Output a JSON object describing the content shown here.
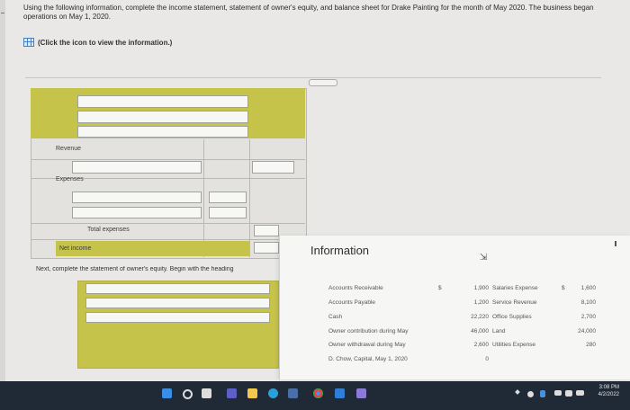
{
  "question": {
    "text": "Using the following information, complete the income statement, statement of owner's equity, and balance sheet for Drake Painting for the month of May 2020. The business began operations on May 1, 2020."
  },
  "info_link": {
    "label": "(Click the icon to view the information.)"
  },
  "income_statement": {
    "revenue_label": "Revenue",
    "expenses_label": "Expenses",
    "total_expenses_label": "Total expenses",
    "net_income_label": "Net income"
  },
  "next_instruction": "Next, complete the statement of owner's equity. Begin with the heading",
  "information_panel": {
    "title": "Information",
    "left_items": [
      {
        "label": "Accounts Receivable",
        "currency": "$",
        "value": "1,900"
      },
      {
        "label": "Accounts Payable",
        "currency": "",
        "value": "1,200"
      },
      {
        "label": "Cash",
        "currency": "",
        "value": "22,220"
      },
      {
        "label": "Owner contribution during May",
        "currency": "",
        "value": "46,000"
      },
      {
        "label": "Owner withdrawal during May",
        "currency": "",
        "value": "2,600"
      },
      {
        "label": "D. Chow, Capital, May 1, 2020",
        "currency": "",
        "value": "0"
      }
    ],
    "right_items": [
      {
        "label": "Salaries Expense",
        "currency": "$",
        "value": "1,600"
      },
      {
        "label": "Service Revenue",
        "currency": "",
        "value": "8,100"
      },
      {
        "label": "Office Supplies",
        "currency": "",
        "value": "2,700"
      },
      {
        "label": "Land",
        "currency": "",
        "value": "24,000"
      },
      {
        "label": "Utilities Expense",
        "currency": "",
        "value": "280"
      }
    ]
  },
  "taskbar": {
    "time": "3:08 PM",
    "date": "4/2/2022",
    "icons": [
      "windows-icon",
      "search-icon",
      "task-view-icon",
      "chat-icon",
      "file-explorer-icon",
      "edge-icon",
      "chrome-icon",
      "store-icon",
      "mail-icon",
      "settings-icon",
      "wifi-icon",
      "volume-icon",
      "battery-icon"
    ]
  }
}
